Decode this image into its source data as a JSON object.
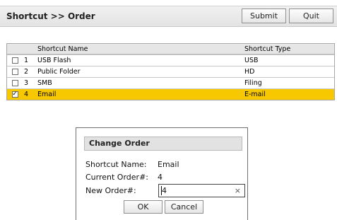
{
  "header": {
    "title": "Shortcut >> Order",
    "submit_label": "Submit",
    "quit_label": "Quit"
  },
  "table": {
    "columns": [
      "Shortcut Name",
      "Shortcut Type"
    ],
    "rows": [
      {
        "index": "1",
        "name": "USB Flash",
        "type": "USB",
        "checked": false
      },
      {
        "index": "2",
        "name": "Public Folder",
        "type": "HD",
        "checked": false
      },
      {
        "index": "3",
        "name": "SMB",
        "type": "Filing",
        "checked": false
      },
      {
        "index": "4",
        "name": "Email",
        "type": "E-mail",
        "checked": true
      }
    ]
  },
  "dialog": {
    "title": "Change Order",
    "shortcut_name_label": "Shortcut Name:",
    "shortcut_name_value": "Email",
    "current_order_label": "Current Order#:",
    "current_order_value": "4",
    "new_order_label": "New Order#:",
    "new_order_value": "4",
    "ok_label": "OK",
    "cancel_label": "Cancel"
  },
  "colors": {
    "selected_row": "#f7c800",
    "header_bar": "#e8e8e8"
  },
  "icons": {
    "check": "✓",
    "clear": "×"
  }
}
